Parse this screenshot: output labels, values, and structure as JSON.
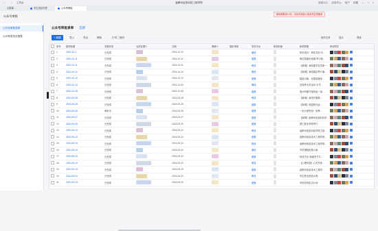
{
  "window": {
    "title": "鑫腾讯信息科技工程学院",
    "nav_left": [
      "←",
      "→",
      "工作台"
    ],
    "right_items": [
      "消息中心",
      "应用中心",
      "用户",
      "设置",
      "—",
      "□",
      "×"
    ]
  },
  "tabs": [
    {
      "label": "大屏幕",
      "active": false
    },
    {
      "label": "学生成绩列表",
      "active": false
    },
    {
      "label": "公众号审批",
      "active": true
    }
  ],
  "banner": "使用期剩余10天，请及时续费以免影响正常使用",
  "sidebar": {
    "app_title": "公众号审批",
    "items": [
      {
        "label": "公众号审批表单",
        "active": true
      },
      {
        "label": "公众号发布日报表",
        "active": false
      }
    ]
  },
  "page": {
    "title": "公众号审批表单",
    "scope": "全部"
  },
  "toolbar": {
    "add": "+ 新建",
    "import": "导入",
    "export": "导出",
    "delete": "删除",
    "print": "打印二维码",
    "settings": "操作记录",
    "more": "显示",
    "filter": "筛选"
  },
  "table": {
    "columns": [
      "序号",
      "新闻标题",
      "流程状态",
      "当前处理人",
      "日期",
      "撰稿人",
      "摄影审核",
      "发布平台",
      "新闻封面",
      "新闻导图",
      "审阅附件"
    ],
    "rows": [
      {
        "no": "1",
        "date": "2024-10-1",
        "status": "已完成",
        "d2": "2024-10-12",
        "platform": "微信"
      },
      {
        "no": "2",
        "date": "2024-10-11",
        "status": "已完成",
        "d2": "2024-10-11",
        "platform": "团委"
      },
      {
        "no": "3",
        "date": "2024-10-11",
        "status": "已完成",
        "d2": "2024-10-11",
        "platform": "教务"
      },
      {
        "no": "4",
        "date": "2024-10-10",
        "status": "已完成",
        "d2": "2024-10-10",
        "platform": "微信"
      },
      {
        "no": "5",
        "date": "2024-10-10",
        "status": "已完成",
        "d2": "2024-10-10",
        "platform": "团委"
      },
      {
        "no": "6",
        "date": "2024-10-10",
        "status": "已完成",
        "d2": "2024-10-09",
        "platform": "微信"
      },
      {
        "no": "7",
        "date": "2024-10-08",
        "status": "已完成",
        "d2": "2024-10-08",
        "platform": "团委"
      },
      {
        "no": "8",
        "date": "2024-09-28",
        "status": "已完成",
        "d2": "2024-09-28",
        "platform": "教务"
      },
      {
        "no": "9",
        "date": "2024-09-28",
        "status": "已完成",
        "d2": "2024-09-28",
        "platform": "团委"
      },
      {
        "no": "10",
        "date": "2024-09-28",
        "status": "审批中",
        "d2": "2024-09-28",
        "platform": "团委"
      },
      {
        "no": "11",
        "date": "2024-09-27",
        "status": "已完成",
        "d2": "2024-09-27",
        "platform": "团委"
      },
      {
        "no": "12",
        "date": "2024-09-25",
        "status": "已完成",
        "d2": "2024-09-25",
        "platform": "团委"
      },
      {
        "no": "13",
        "date": "2024-09-24",
        "status": "已完成",
        "d2": "2024-09-24",
        "platform": "教务"
      },
      {
        "no": "14",
        "date": "2024-09-24",
        "status": "已完成",
        "d2": "2024-09-24",
        "platform": "团委"
      },
      {
        "no": "15",
        "date": "2024-09-24",
        "status": "已完成",
        "d2": "2024-09-24",
        "platform": "教务"
      },
      {
        "no": "16",
        "date": "2024-09-24",
        "status": "已完成",
        "d2": "2024-09-24",
        "platform": "微信"
      },
      {
        "no": "17",
        "date": "2024-09-24",
        "status": "已完成",
        "d2": "2024-09-24",
        "platform": "团委"
      },
      {
        "no": "18",
        "date": "2024-09-23",
        "status": "已完成",
        "d2": "2024-09-23",
        "platform": "教务"
      },
      {
        "no": "19",
        "date": "2024-09-23",
        "status": "已完成",
        "d2": "2024-09-23",
        "platform": "团委"
      },
      {
        "no": "20",
        "date": "2024-09-23",
        "status": "已完成",
        "d2": "2024-09-23",
        "platform": "教务"
      },
      {
        "no": "21",
        "date": "2024-09-23",
        "status": "已完成",
        "d2": "2024-09-23",
        "platform": "团委"
      }
    ],
    "captions": [
      "携手成长！帮扶共创·中…",
      "明日智能科技展·举行新…",
      "【新闻】我校团学社员新一…",
      "【新闻】我校园区举行演…",
      "智能大脑，全国高速信…",
      "这特杯大学活动·中华…",
      "德州市图书馆来赵一道…",
      "【新闻】我校开展第…",
      "【新闻】校园阳光运…",
      "一封大家的信！秋季…",
      "【新闻】鑫腾讯信息科技学…",
      "理工职业学院举行…",
      "鑫腾讯信息科技学院工程…",
      "鑫腾讯信息技术工程学院…",
      "鑫腾讯信息技术工程学院…",
      "开学课程实践小组…",
      "科技文化·我建学子共…",
      "【心理情感】心灵开放…",
      "鑫腾讯信息技术工程学…",
      "学生职业规划大赛…",
      "学校领导走访计划…"
    ],
    "colors": {
      "accent": "#1e6ee8"
    }
  }
}
